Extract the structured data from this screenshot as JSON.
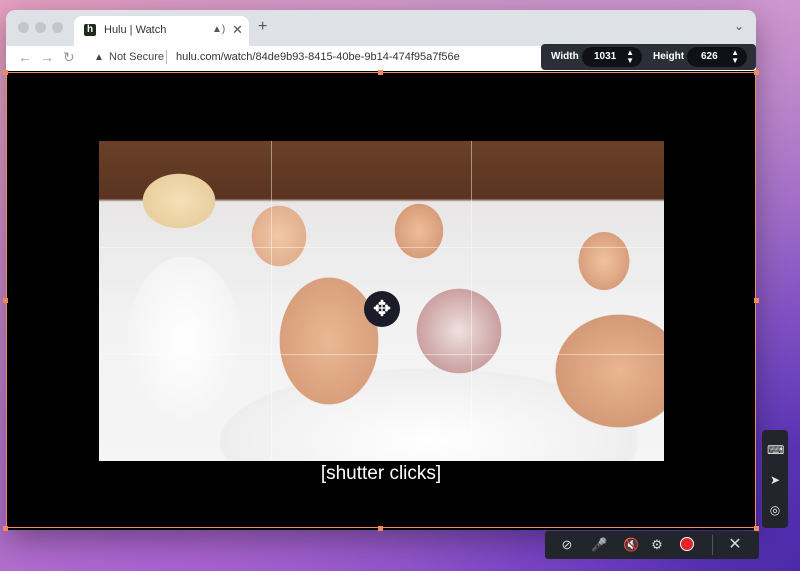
{
  "browser": {
    "tab": {
      "title": "Hulu | Watch",
      "favicon_letter": "h"
    },
    "address": {
      "security": "Not Secure",
      "url": "hulu.com/watch/84de9b93-8415-40be-9b14-474f95a7f56e"
    }
  },
  "video": {
    "caption": "[shutter clicks]"
  },
  "capture": {
    "width_label": "Width",
    "width_value": "1031",
    "height_label": "Height",
    "height_value": "626"
  },
  "colors": {
    "selection_border": "#f08a5d",
    "record": "#e52525"
  }
}
